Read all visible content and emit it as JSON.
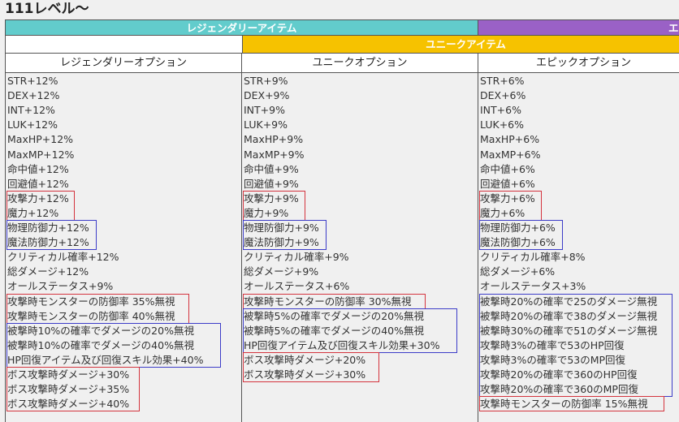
{
  "heading": "111レベル～",
  "bands": {
    "legendary": "レジェンダリーアイテム",
    "epic": "エ",
    "unique": "ユニークアイテム"
  },
  "columns": [
    {
      "header": "レジェンダリーオプション",
      "lines": [
        "STR+12%",
        "DEX+12%",
        "INT+12%",
        "LUK+12%",
        "MaxHP+12%",
        "MaxMP+12%",
        "命中値+12%",
        "回避値+12%",
        "攻撃力+12%",
        "魔力+12%",
        "物理防御力+12%",
        "魔法防御力+12%",
        "クリティカル確率+12%",
        "総ダメージ+12%",
        "オールステータス+9%",
        "攻撃時モンスターの防御率 35%無視",
        "攻撃時モンスターの防御率 40%無視",
        "被撃時10%の確率でダメージの20%無視",
        "被撃時10%の確率でダメージの40%無視",
        "HP回復アイテム及び回復スキル効果+40%",
        "ボス攻撃時ダメージ+30%",
        "ボス攻撃時ダメージ+35%",
        "ボス攻撃時ダメージ+40%"
      ]
    },
    {
      "header": "ユニークオプション",
      "lines": [
        "STR+9%",
        "DEX+9%",
        "INT+9%",
        "LUK+9%",
        "MaxHP+9%",
        "MaxMP+9%",
        "命中値+9%",
        "回避値+9%",
        "攻撃力+9%",
        "魔力+9%",
        "物理防御力+9%",
        "魔法防御力+9%",
        "クリティカル確率+9%",
        "総ダメージ+9%",
        "オールステータス+6%",
        "攻撃時モンスターの防御率 30%無視",
        "被撃時5%の確率でダメージの20%無視",
        "被撃時5%の確率でダメージの40%無視",
        "HP回復アイテム及び回復スキル効果+30%",
        "ボス攻撃時ダメージ+20%",
        "ボス攻撃時ダメージ+30%"
      ]
    },
    {
      "header": "エピックオプション",
      "lines": [
        "STR+6%",
        "DEX+6%",
        "INT+6%",
        "LUK+6%",
        "MaxHP+6%",
        "MaxMP+6%",
        "命中値+6%",
        "回避値+6%",
        "攻撃力+6%",
        "魔力+6%",
        "物理防御力+6%",
        "魔法防御力+6%",
        "クリティカル確率+8%",
        "総ダメージ+6%",
        "オールステータス+3%",
        "被撃時20%の確率で25のダメージ無視",
        "被撃時20%の確率で38のダメージ無視",
        "被撃時30%の確率で51のダメージ無視",
        "攻撃時3%の確率で53のHP回復",
        "攻撃時3%の確率で53のMP回復",
        "攻撃時20%の確率で360のHP回復",
        "攻撃時20%の確率で360のMP回復",
        "攻撃時モンスターの防御率 15%無視"
      ]
    }
  ],
  "colors": {
    "red_box": "#d4343e",
    "blue_box": "#3c3cc8",
    "legendary": "#62cccc",
    "unique": "#f6c200",
    "epic": "#9a61c6"
  }
}
